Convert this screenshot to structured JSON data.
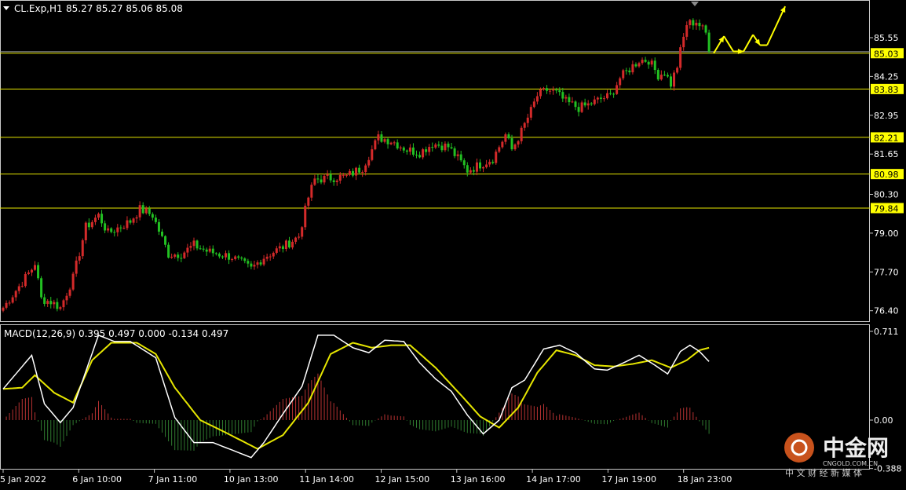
{
  "header": {
    "symbol": "CL.Exp,H1",
    "ohlc": "85.27 85.27 85.06 85.08",
    "macd_label": "MACD(12,26,9) 0.395 0.497 0.000 -0.134 0.497"
  },
  "watermark": {
    "brand": "中金网",
    "domain": "CNGOLD.COM.CN",
    "slogan": "中 文 财 经 新 媒 体"
  },
  "colors": {
    "background": "#000000",
    "frame": "#c8c8c8",
    "bull": "#d42a2a",
    "bear": "#22c022",
    "level_line": "#e6e600",
    "level_box": "#ffff00",
    "macd_line": "#ffffff",
    "signal_line": "#e6e600",
    "hist_up": "#b83232",
    "hist_down": "#2f7a2f",
    "forecast_arrow": "#ffff00"
  },
  "chart_data": [
    {
      "type": "candlestick",
      "name": "price",
      "y_ticks": [
        "85.55",
        "84.25",
        "82.95",
        "81.65",
        "80.30",
        "79.00",
        "77.70",
        "76.40"
      ],
      "x_ticks": [
        "5 Jan 2022",
        "6 Jan 10:00",
        "7 Jan 11:00",
        "10 Jan 13:00",
        "11 Jan 14:00",
        "12 Jan 15:00",
        "13 Jan 16:00",
        "14 Jan 17:00",
        "17 Jan 19:00",
        "18 Jan 23:00"
      ],
      "levels": [
        "85.03",
        "83.83",
        "82.21",
        "80.98",
        "79.84"
      ],
      "last_price": 85.08,
      "ylim": [
        76.0,
        86.3
      ],
      "anchors": [
        [
          0,
          76.5
        ],
        [
          9,
          77.8
        ],
        [
          10,
          78.0
        ],
        [
          12,
          76.8
        ],
        [
          15,
          76.7
        ],
        [
          18,
          76.5
        ],
        [
          22,
          77.5
        ],
        [
          26,
          79.2
        ],
        [
          30,
          79.6
        ],
        [
          33,
          79.0
        ],
        [
          40,
          79.4
        ],
        [
          43,
          79.8
        ],
        [
          47,
          79.6
        ],
        [
          52,
          78.3
        ],
        [
          56,
          78.3
        ],
        [
          60,
          78.6
        ],
        [
          64,
          78.4
        ],
        [
          72,
          78.2
        ],
        [
          78,
          77.8
        ],
        [
          82,
          78.2
        ],
        [
          89,
          78.6
        ],
        [
          93,
          78.9
        ],
        [
          96,
          80.2
        ],
        [
          98,
          80.8
        ],
        [
          108,
          80.9
        ],
        [
          113,
          81.2
        ],
        [
          118,
          82.2
        ],
        [
          122,
          82.1
        ],
        [
          127,
          81.8
        ],
        [
          131,
          81.7
        ],
        [
          135,
          82.0
        ],
        [
          140,
          81.9
        ],
        [
          143,
          81.5
        ],
        [
          146,
          81.1
        ],
        [
          150,
          81.3
        ],
        [
          154,
          81.5
        ],
        [
          158,
          82.3
        ],
        [
          160,
          81.8
        ],
        [
          163,
          82.4
        ],
        [
          166,
          83.1
        ],
        [
          168,
          83.6
        ],
        [
          171,
          83.8
        ],
        [
          174,
          83.7
        ],
        [
          177,
          83.4
        ],
        [
          181,
          83.2
        ],
        [
          184,
          83.3
        ],
        [
          188,
          83.5
        ],
        [
          191,
          83.6
        ],
        [
          194,
          84.2
        ],
        [
          197,
          84.5
        ],
        [
          200,
          84.8
        ],
        [
          203,
          84.8
        ],
        [
          206,
          84.3
        ],
        [
          208,
          84.4
        ],
        [
          210,
          84.0
        ],
        [
          212,
          84.6
        ],
        [
          213,
          85.1
        ],
        [
          215,
          86.0
        ],
        [
          218,
          86.1
        ],
        [
          221,
          85.7
        ],
        [
          222,
          85.08
        ]
      ],
      "forecast": [
        [
          85.03,
          85.6,
          85.09
        ],
        [
          85.09,
          85.65,
          85.3
        ],
        [
          85.3,
          86.6
        ]
      ]
    },
    {
      "type": "histogram+line",
      "name": "MACD(12,26,9)",
      "y_ticks": [
        "0.711",
        "0.00",
        "-0.388"
      ],
      "ylim": [
        -0.45,
        0.76
      ],
      "macd_anchors": [
        [
          0,
          0.25
        ],
        [
          9,
          0.52
        ],
        [
          13,
          0.13
        ],
        [
          18,
          -0.02
        ],
        [
          22,
          0.1
        ],
        [
          30,
          0.68
        ],
        [
          35,
          0.63
        ],
        [
          40,
          0.63
        ],
        [
          48,
          0.5
        ],
        [
          54,
          0.02
        ],
        [
          60,
          -0.18
        ],
        [
          66,
          -0.18
        ],
        [
          73,
          -0.25
        ],
        [
          78,
          -0.3
        ],
        [
          82,
          -0.18
        ],
        [
          88,
          0.05
        ],
        [
          94,
          0.27
        ],
        [
          99,
          0.68
        ],
        [
          104,
          0.68
        ],
        [
          110,
          0.58
        ],
        [
          115,
          0.54
        ],
        [
          120,
          0.64
        ],
        [
          126,
          0.63
        ],
        [
          131,
          0.46
        ],
        [
          136,
          0.33
        ],
        [
          141,
          0.23
        ],
        [
          146,
          0.04
        ],
        [
          151,
          -0.11
        ],
        [
          156,
          0.0
        ],
        [
          160,
          0.26
        ],
        [
          164,
          0.32
        ],
        [
          170,
          0.57
        ],
        [
          175,
          0.6
        ],
        [
          180,
          0.54
        ],
        [
          186,
          0.41
        ],
        [
          190,
          0.4
        ],
        [
          196,
          0.47
        ],
        [
          200,
          0.52
        ],
        [
          205,
          0.44
        ],
        [
          209,
          0.37
        ],
        [
          213,
          0.55
        ],
        [
          216,
          0.6
        ],
        [
          219,
          0.55
        ],
        [
          222,
          0.47
        ]
      ],
      "signal_anchors": [
        [
          0,
          0.25
        ],
        [
          6,
          0.26
        ],
        [
          10,
          0.36
        ],
        [
          16,
          0.22
        ],
        [
          22,
          0.14
        ],
        [
          28,
          0.48
        ],
        [
          34,
          0.62
        ],
        [
          42,
          0.62
        ],
        [
          48,
          0.53
        ],
        [
          54,
          0.26
        ],
        [
          62,
          0.0
        ],
        [
          70,
          -0.1
        ],
        [
          80,
          -0.23
        ],
        [
          88,
          -0.12
        ],
        [
          96,
          0.14
        ],
        [
          103,
          0.53
        ],
        [
          110,
          0.62
        ],
        [
          116,
          0.58
        ],
        [
          122,
          0.6
        ],
        [
          128,
          0.6
        ],
        [
          136,
          0.42
        ],
        [
          144,
          0.2
        ],
        [
          150,
          0.03
        ],
        [
          156,
          -0.06
        ],
        [
          162,
          0.1
        ],
        [
          168,
          0.38
        ],
        [
          174,
          0.56
        ],
        [
          180,
          0.52
        ],
        [
          186,
          0.44
        ],
        [
          192,
          0.43
        ],
        [
          198,
          0.45
        ],
        [
          204,
          0.48
        ],
        [
          210,
          0.42
        ],
        [
          215,
          0.48
        ],
        [
          219,
          0.56
        ],
        [
          222,
          0.58
        ]
      ]
    }
  ]
}
